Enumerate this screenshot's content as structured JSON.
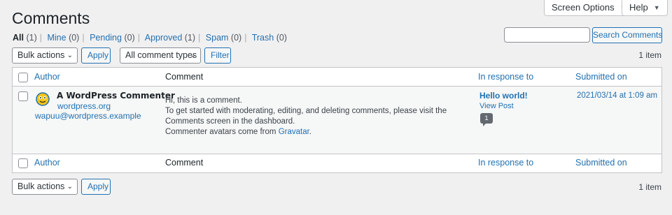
{
  "header": {
    "title": "Comments",
    "screen_options": "Screen Options",
    "help": "Help"
  },
  "filters": [
    {
      "label": "All",
      "count": "(1)"
    },
    {
      "label": "Mine",
      "count": "(0)"
    },
    {
      "label": "Pending",
      "count": "(0)"
    },
    {
      "label": "Approved",
      "count": "(1)"
    },
    {
      "label": "Spam",
      "count": "(0)"
    },
    {
      "label": "Trash",
      "count": "(0)"
    }
  ],
  "search": {
    "placeholder": "",
    "button": "Search Comments"
  },
  "toolbar_top": {
    "bulk_actions": "Bulk actions",
    "apply": "Apply",
    "comment_types": "All comment types",
    "filter": "Filter",
    "item_count": "1 item"
  },
  "table": {
    "columns": {
      "author": "Author",
      "comment": "Comment",
      "in_response_to": "In response to",
      "submitted_on": "Submitted on"
    },
    "row": {
      "author_name": "A WordPress Commenter",
      "author_url": "wordpress.org",
      "author_email": "wapuu@wordpress.example",
      "comment_line1": "Hi, this is a comment.",
      "comment_line2": "To get started with moderating, editing, and deleting comments, please visit the Comments screen in the dashboard.",
      "comment_line3_prefix": "Commenter avatars come from ",
      "comment_line3_link": "Gravatar",
      "comment_line3_suffix": ".",
      "response_title": "Hello world!",
      "view_post": "View Post",
      "comment_count": "1",
      "submitted_on": "2021/03/14 at 1:09 am"
    }
  },
  "toolbar_bottom": {
    "bulk_actions": "Bulk actions",
    "apply": "Apply",
    "item_count": "1 item"
  },
  "colors": {
    "accent": "#2271b1",
    "background": "#f0f0f1",
    "row_alt": "#f6f7f7",
    "border": "#c3c4c7"
  }
}
